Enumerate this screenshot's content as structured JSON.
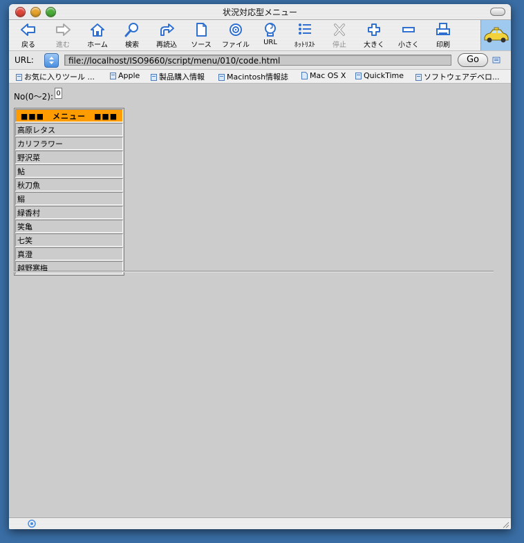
{
  "window": {
    "title": "状況対応型メニュー"
  },
  "toolbar": {
    "items": [
      {
        "label": "戻る",
        "icon": "back-arrow-icon"
      },
      {
        "label": "進む",
        "icon": "forward-arrow-icon",
        "disabled": true
      },
      {
        "label": "ホーム",
        "icon": "home-icon"
      },
      {
        "label": "検索",
        "icon": "search-icon"
      },
      {
        "label": "再読込",
        "icon": "reload-icon"
      },
      {
        "label": "ソース",
        "icon": "source-document-icon"
      },
      {
        "label": "ファイル",
        "icon": "file-target-icon"
      },
      {
        "label": "URL",
        "icon": "url-icon"
      },
      {
        "label": "ﾎｯﾄﾘｽﾄ",
        "icon": "hotlist-icon"
      },
      {
        "label": "停止",
        "icon": "stop-icon",
        "disabled": true
      },
      {
        "label": "大きく",
        "icon": "plus-icon"
      },
      {
        "label": "小さく",
        "icon": "minus-icon"
      },
      {
        "label": "印刷",
        "icon": "print-icon"
      }
    ]
  },
  "address": {
    "label": "URL:",
    "value": "file://localhost/ISO9660/script/menu/010/code.html",
    "go_label": "Go"
  },
  "favorites": [
    {
      "label": "お気に入りツール ..."
    },
    {
      "label": "Apple"
    },
    {
      "label": "製品購入情報"
    },
    {
      "label": "Macintosh情報誌"
    },
    {
      "label": "Mac OS X"
    },
    {
      "label": "QuickTime"
    },
    {
      "label": "ソフトウェアデベロ..."
    }
  ],
  "page": {
    "no_label": "No(0〜2):",
    "no_value": "0",
    "menu_header": "■■■　メニュー　■■■",
    "menu_items": [
      "高原レタス",
      "カリフラワー",
      "野沢菜",
      "鮎",
      "秋刀魚",
      "鰯",
      "緑香村",
      "笑亀",
      "七笑",
      "真澄",
      "越野寒梅"
    ]
  },
  "colors": {
    "menu_header_bg": "#ff9d00",
    "content_bg": "#cccccc",
    "accent_blue": "#4a8ee0"
  }
}
